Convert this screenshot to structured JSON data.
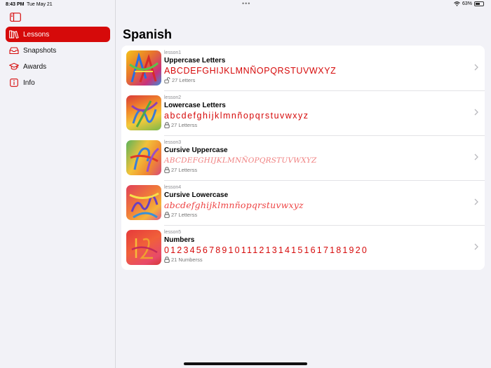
{
  "status": {
    "time": "8:43 PM",
    "date": "Tue May 21",
    "dots": "•••",
    "battery": "63%",
    "battery_level": 0.63
  },
  "sidebar": {
    "items": [
      {
        "label": "Lessons",
        "icon": "books-icon",
        "active": true
      },
      {
        "label": "Snapshots",
        "icon": "tray-icon",
        "active": false
      },
      {
        "label": "Awards",
        "icon": "graduation-cap-icon",
        "active": false
      },
      {
        "label": "Info",
        "icon": "info-icon",
        "active": false
      }
    ]
  },
  "main": {
    "title": "Spanish",
    "lessons": [
      {
        "id": "lesson1",
        "title": "Uppercase Letters",
        "letters": "ABCDEFGHIJKLMNÑOPQRSTUVWXYZ",
        "meta": "27 Letters",
        "status_icon": "unlocked-icon"
      },
      {
        "id": "lesson2",
        "title": "Lowercase Letters",
        "letters": "abcdefghijklmnñopqrstuvwxyz",
        "meta": "27 Letterss",
        "status_icon": "lock-icon"
      },
      {
        "id": "lesson3",
        "title": "Cursive Uppercase",
        "letters": "ABCDEFGHIJKLMNÑOPQRSTUVWXYZ",
        "meta": "27 Letterss",
        "status_icon": "lock-icon"
      },
      {
        "id": "lesson4",
        "title": "Cursive Lowercase",
        "letters": "abcdefghijklmnñopqrstuvwxyz",
        "meta": "27 Letterss",
        "status_icon": "lock-icon"
      },
      {
        "id": "lesson5",
        "title": "Numbers",
        "letters": "01234567891011121314151617181920",
        "meta": "21 Numberss",
        "status_icon": "lock-icon"
      }
    ]
  },
  "colors": {
    "accent": "#d60a0a",
    "background": "#f2f2f7",
    "card": "#ffffff"
  }
}
